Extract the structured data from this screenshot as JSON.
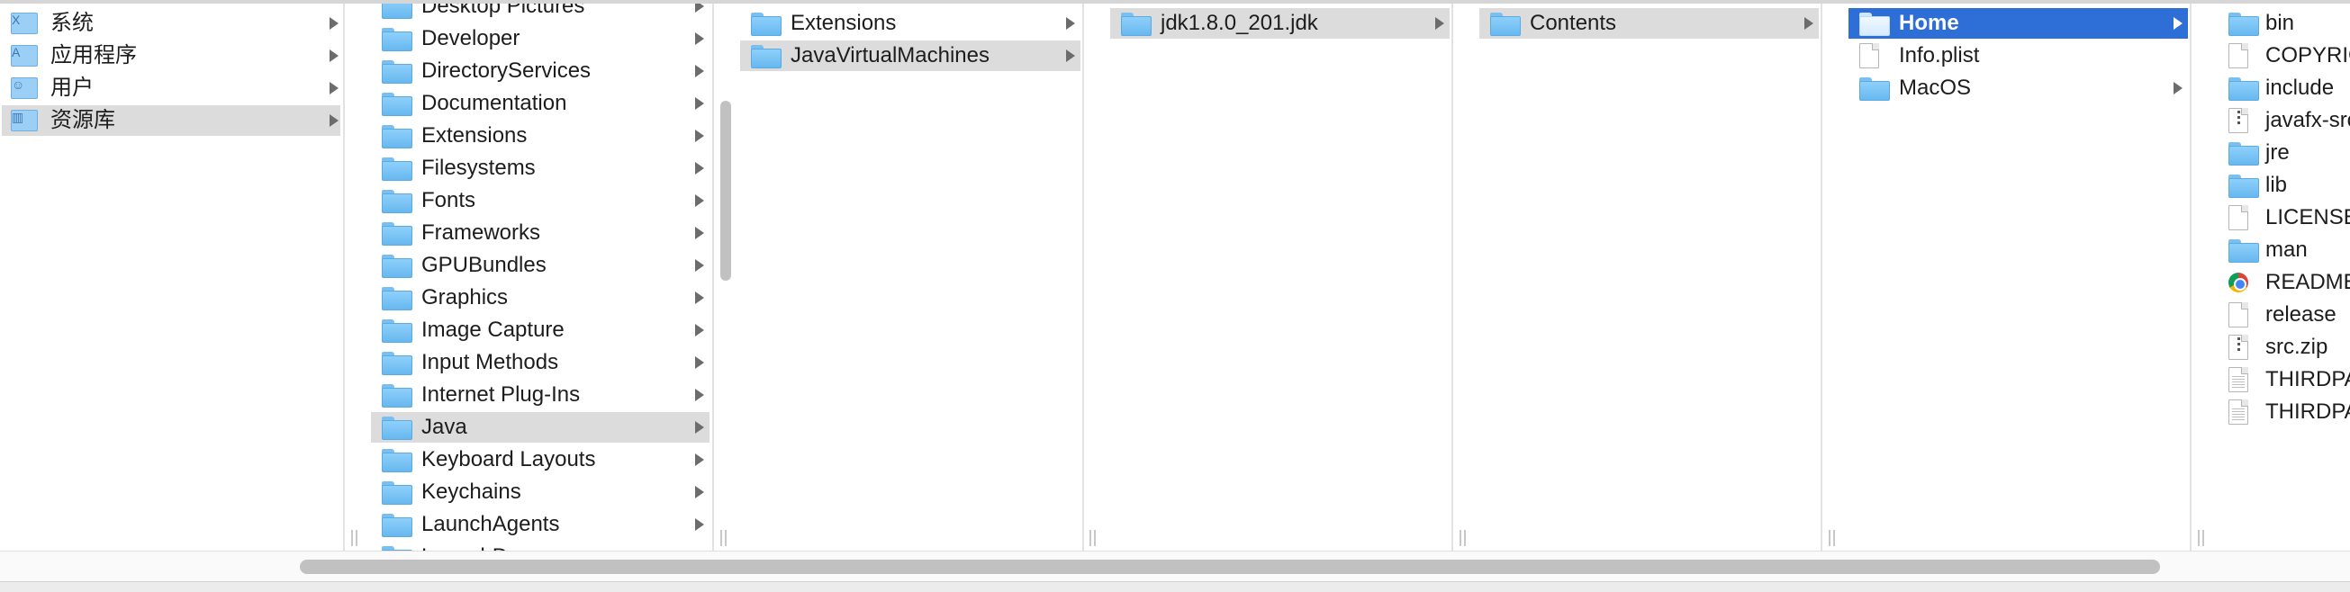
{
  "sidebar": {
    "items": [
      {
        "label": "系统",
        "icon": "system-folder-icon",
        "glyph": "X",
        "selected": false
      },
      {
        "label": "应用程序",
        "icon": "applications-folder-icon",
        "glyph": "A",
        "selected": false
      },
      {
        "label": "用户",
        "icon": "users-folder-icon",
        "glyph": "☺",
        "selected": false
      },
      {
        "label": "资源库",
        "icon": "library-folder-icon",
        "glyph": "▥",
        "selected": true
      }
    ]
  },
  "columns": [
    {
      "name": "library",
      "items": [
        {
          "label": "Desktop Pictures",
          "type": "folder",
          "arrow": true
        },
        {
          "label": "Developer",
          "type": "folder",
          "arrow": true
        },
        {
          "label": "DirectoryServices",
          "type": "folder",
          "arrow": true
        },
        {
          "label": "Documentation",
          "type": "folder",
          "arrow": true
        },
        {
          "label": "Extensions",
          "type": "folder",
          "arrow": true
        },
        {
          "label": "Filesystems",
          "type": "folder",
          "arrow": true
        },
        {
          "label": "Fonts",
          "type": "folder",
          "arrow": true
        },
        {
          "label": "Frameworks",
          "type": "folder",
          "arrow": true
        },
        {
          "label": "GPUBundles",
          "type": "folder",
          "arrow": true
        },
        {
          "label": "Graphics",
          "type": "folder",
          "arrow": true
        },
        {
          "label": "Image Capture",
          "type": "folder",
          "arrow": true
        },
        {
          "label": "Input Methods",
          "type": "folder",
          "arrow": true
        },
        {
          "label": "Internet Plug-Ins",
          "type": "folder",
          "arrow": true
        },
        {
          "label": "Java",
          "type": "folder",
          "arrow": true,
          "selected": "gray"
        },
        {
          "label": "Keyboard Layouts",
          "type": "folder",
          "arrow": true
        },
        {
          "label": "Keychains",
          "type": "folder",
          "arrow": true
        },
        {
          "label": "LaunchAgents",
          "type": "folder",
          "arrow": true
        },
        {
          "label": "LaunchDaemons",
          "type": "folder",
          "arrow": true
        }
      ]
    },
    {
      "name": "java",
      "items": [
        {
          "label": "Extensions",
          "type": "folder",
          "arrow": true
        },
        {
          "label": "JavaVirtualMachines",
          "type": "folder",
          "arrow": true,
          "selected": "gray"
        }
      ]
    },
    {
      "name": "jvms",
      "items": [
        {
          "label": "jdk1.8.0_201.jdk",
          "type": "folder",
          "arrow": true,
          "selected": "gray"
        }
      ]
    },
    {
      "name": "jdk",
      "items": [
        {
          "label": "Contents",
          "type": "folder",
          "arrow": true,
          "selected": "gray"
        }
      ]
    },
    {
      "name": "contents",
      "items": [
        {
          "label": "Home",
          "type": "folder",
          "arrow": true,
          "selected": "blue"
        },
        {
          "label": "Info.plist",
          "type": "doc",
          "arrow": false
        },
        {
          "label": "MacOS",
          "type": "folder",
          "arrow": true
        }
      ]
    },
    {
      "name": "home",
      "items": [
        {
          "label": "bin",
          "type": "folder",
          "arrow": false
        },
        {
          "label": "COPYRIGHT",
          "type": "doc",
          "arrow": false
        },
        {
          "label": "include",
          "type": "folder",
          "arrow": false
        },
        {
          "label": "javafx-src.zip",
          "type": "zip",
          "arrow": false
        },
        {
          "label": "jre",
          "type": "folder",
          "arrow": false
        },
        {
          "label": "lib",
          "type": "folder",
          "arrow": false
        },
        {
          "label": "LICENSE",
          "type": "doc",
          "arrow": false
        },
        {
          "label": "man",
          "type": "folder",
          "arrow": false
        },
        {
          "label": "README.html",
          "type": "chrome",
          "arrow": false
        },
        {
          "label": "release",
          "type": "doc",
          "arrow": false
        },
        {
          "label": "src.zip",
          "type": "zip",
          "arrow": false
        },
        {
          "label": "THIRDPARTYLICENSEREADME-JAVAFX.txt",
          "type": "lines",
          "arrow": false
        },
        {
          "label": "THIRDPARTYLICENSEREADME.txt",
          "type": "lines",
          "arrow": false
        }
      ]
    }
  ],
  "colors": {
    "selection_blue": "#2d6ed7",
    "selection_gray": "#dcdcdc",
    "folder_blue": "#79bff0"
  }
}
